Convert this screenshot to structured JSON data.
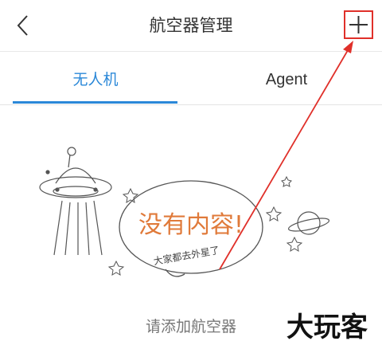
{
  "header": {
    "title": "航空器管理",
    "back_icon": "chevron-left-icon",
    "add_icon": "plus-icon"
  },
  "tabs": [
    {
      "label": "无人机",
      "active": true
    },
    {
      "label": "Agent",
      "active": false
    }
  ],
  "empty_state": {
    "bubble_text": "没有内容!",
    "bubble_subtext": "大家都去外星了",
    "hint": "请添加航空器"
  },
  "watermark": {
    "text": "大玩客"
  },
  "colors": {
    "accent": "#2b88d8",
    "annotation": "#e0302a",
    "bubble_text": "#e07a3a"
  }
}
